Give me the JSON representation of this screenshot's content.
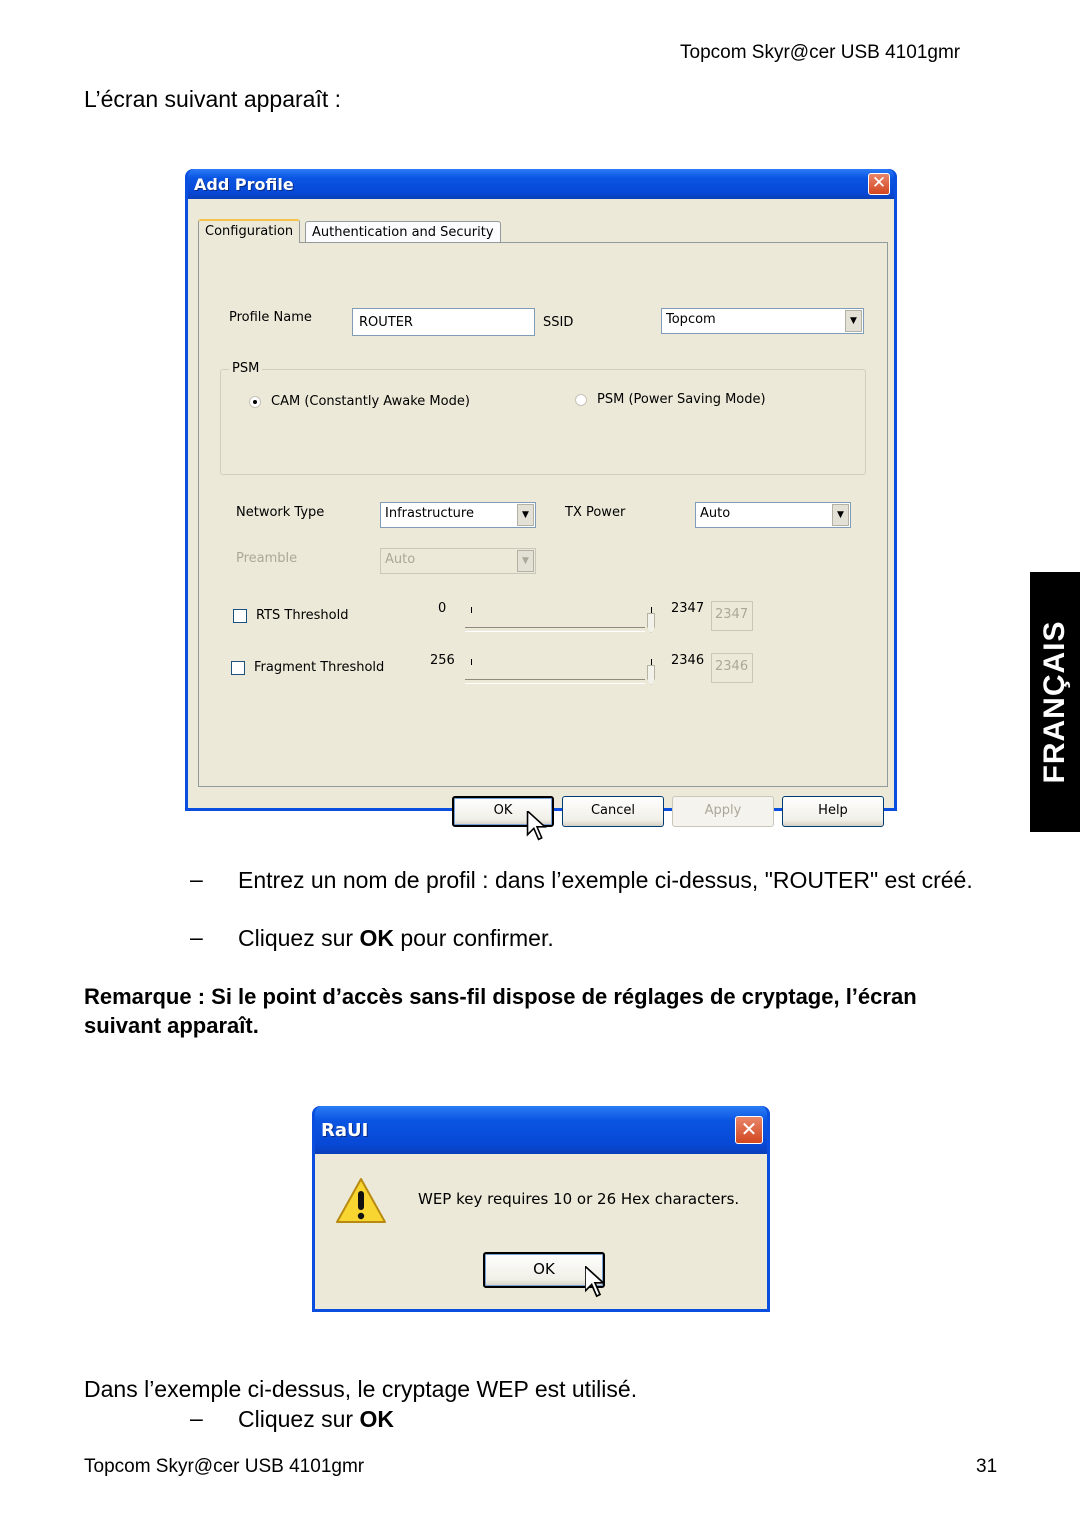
{
  "page": {
    "running_head": "Topcom Skyr@cer USB 4101gmr",
    "intro": "L’écran suivant apparaît :",
    "bullets_1": [
      {
        "dash": "–",
        "text_html_parts": [
          "Entrez un nom de profil : dans l’exemple ci-dessus, \"ROUTER\" est créé."
        ]
      },
      {
        "dash": "–",
        "pre": "Cliquez sur ",
        "bold": "OK",
        "post": " pour confirmer."
      }
    ],
    "note": "Remarque : Si le point d’accès sans-fil dispose de réglages de cryptage, l’écran suivant apparaît.",
    "outro": "Dans l’exemple ci-dessus, le cryptage WEP est utilisé.",
    "bullet_2": {
      "dash": "–",
      "pre": "Cliquez sur ",
      "bold": "OK"
    },
    "footer_left": "Topcom Skyr@cer USB 4101gmr",
    "footer_right": "31",
    "language_tab": "FRANÇAIS"
  },
  "add_profile_dialog": {
    "title": "Add Profile",
    "close_glyph": "✕",
    "tabs": [
      {
        "label": "Configuration",
        "active": true
      },
      {
        "label": "Authentication and Security",
        "active": false
      }
    ],
    "profile_name_label": "Profile Name",
    "profile_name_value": "ROUTER",
    "ssid_label": "SSID",
    "ssid_value": "Topcom",
    "psm_group_label": "PSM",
    "psm_options": [
      {
        "label": "CAM (Constantly Awake Mode)",
        "selected": true
      },
      {
        "label": "PSM (Power Saving Mode)",
        "selected": false
      }
    ],
    "network_type_label": "Network Type",
    "network_type_value": "Infrastructure",
    "tx_power_label": "TX Power",
    "tx_power_value": "Auto",
    "preamble_label": "Preamble",
    "preamble_value": "Auto",
    "rts": {
      "label": "RTS Threshold",
      "checked": false,
      "min": "0",
      "max": "2347",
      "value": "2347"
    },
    "fragment": {
      "label": "Fragment Threshold",
      "checked": false,
      "min": "256",
      "max": "2346",
      "value": "2346"
    },
    "buttons": {
      "ok": "OK",
      "cancel": "Cancel",
      "apply": "Apply",
      "help": "Help"
    },
    "dropdown_arrow": "▼"
  },
  "raui_dialog": {
    "title": "RaUI",
    "close_glyph": "✕",
    "message": "WEP key requires 10 or 26 Hex characters.",
    "ok": "OK",
    "icon": "warning-icon"
  },
  "colors": {
    "xp_title_blue": "#0a4ee0",
    "xp_face": "#ece9d8",
    "close_red": "#d2461f",
    "warning_yellow": "#f8d530"
  }
}
